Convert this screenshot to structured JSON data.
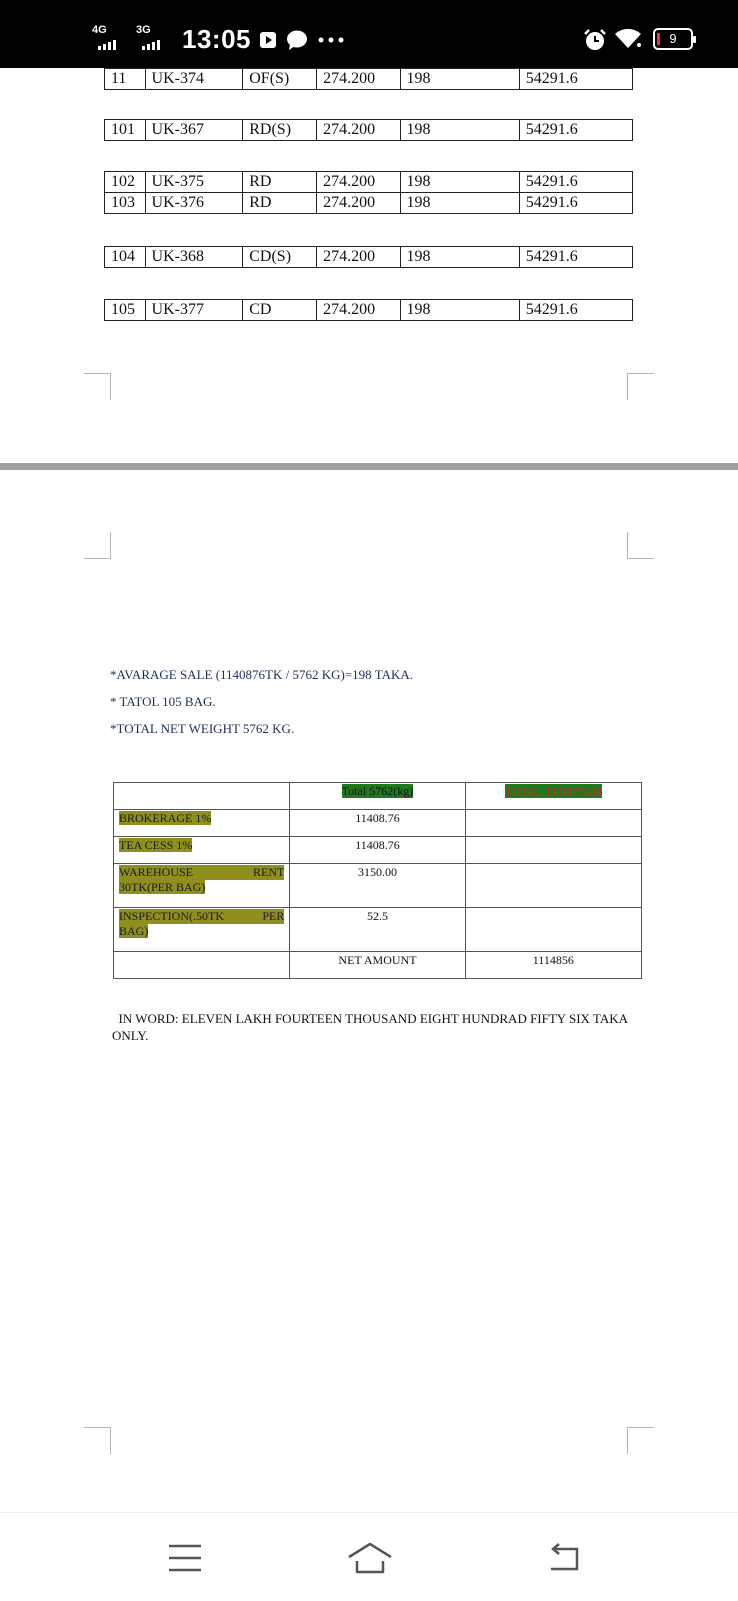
{
  "status_bar": {
    "network_1": "4G",
    "network_2": "3G",
    "time": "13:05",
    "battery": "9",
    "icons": [
      "play-icon",
      "chat-bubble-icon",
      "more-dots-icon",
      "alarm-icon",
      "wifi-icon",
      "battery-icon"
    ]
  },
  "rows": [
    [
      "11",
      "UK-374",
      "OF(S)",
      "274.200",
      "198",
      "54291.6"
    ],
    [
      "101",
      "UK-367",
      "RD(S)",
      "274.200",
      "198",
      "54291.6"
    ],
    [
      "102",
      "UK-375",
      "RD",
      "274.200",
      "198",
      "54291.6"
    ],
    [
      "103",
      "UK-376",
      "RD",
      "274.200",
      "198",
      "54291.6"
    ],
    [
      "104",
      "UK-368",
      "CD(S)",
      "274.200",
      "198",
      "54291.6"
    ],
    [
      "105",
      "UK-377",
      "CD",
      "274.200",
      "198",
      "54291.6"
    ]
  ],
  "notes": {
    "line1": "*AVARAGE SALE (1140876TK / 5762 KG)=198 TAKA.",
    "line2": "* TATOL 105 BAG.",
    "line3": "*TOTAL NET WEIGHT 5762 KG."
  },
  "summary": {
    "header_total_kg": "Total 5762(kg)",
    "header_total_tk": "TOTAL 1140876.00",
    "brokerage_label": "BROKERAGE 1%",
    "brokerage_value": "11408.76",
    "tea_cess_label": "TEA CESS 1%",
    "tea_cess_value": "11408.76",
    "warehouse_label_a": "WAREHOUSE",
    "warehouse_label_b": "RENT",
    "warehouse_label_c": "30TK(PER BAG)",
    "warehouse_value": "3150.00",
    "inspection_label_a": "INSPECTION(.50TK",
    "inspection_label_b": "PER",
    "inspection_label_c": "BAG)",
    "inspection_value": "52.5",
    "net_amount_label": "NET AMOUNT",
    "net_amount_value": "1114856"
  },
  "in_word": "IN WORD: ELEVEN LAKH FOURTEEN THOUSAND EIGHT HUNDRAD FIFTY SIX TAKA ONLY.",
  "colors": {
    "olive_highlight": "#8f8f1d",
    "green_highlight": "#1f7a1f",
    "red_text": "#c62828",
    "note_text": "#1c2f5a"
  },
  "nav": {
    "icons": [
      "recent-apps-icon",
      "home-icon",
      "back-icon"
    ]
  }
}
